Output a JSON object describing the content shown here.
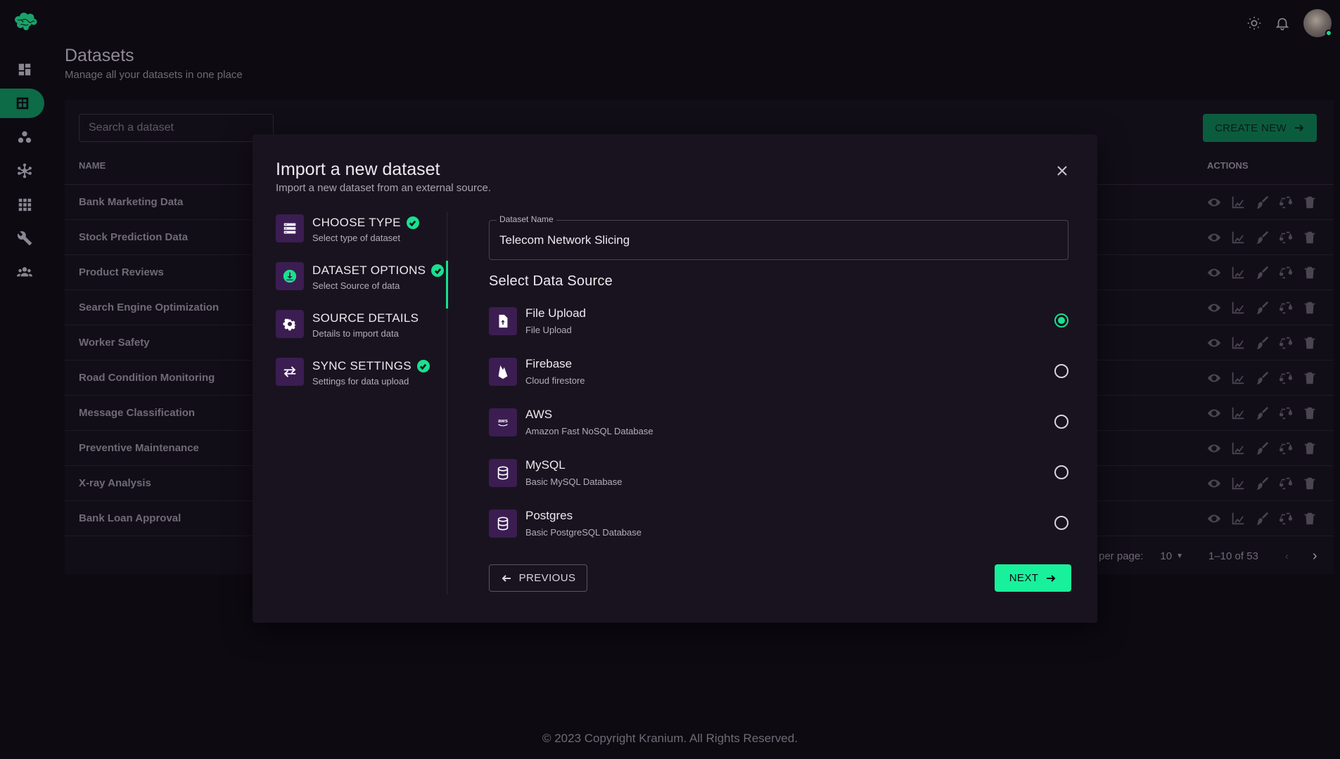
{
  "page": {
    "title": "Datasets",
    "subtitle": "Manage all your datasets in one place",
    "footer": "© 2023 Copyright Kranium. All Rights Reserved."
  },
  "sidebar": {
    "items": [
      {
        "icon": "dashboard-icon",
        "active": false
      },
      {
        "icon": "datasets-icon",
        "active": true
      },
      {
        "icon": "clusters-icon",
        "active": false
      },
      {
        "icon": "network-icon",
        "active": false
      },
      {
        "icon": "apps-grid-icon",
        "active": false
      },
      {
        "icon": "wrench-icon",
        "active": false
      },
      {
        "icon": "team-icon",
        "active": false
      }
    ]
  },
  "table": {
    "search_placeholder": "Search a dataset",
    "create_label": "CREATE NEW",
    "col_name": "NAME",
    "col_actions": "ACTIONS",
    "rows": [
      "Bank Marketing Data",
      "Stock Prediction Data",
      "Product Reviews",
      "Search Engine Optimization",
      "Worker Safety",
      "Road Condition Monitoring",
      "Message Classification",
      "Preventive Maintenance",
      "X-ray Analysis",
      "Bank Loan Approval"
    ],
    "pagination": {
      "per_page_label": "per page:",
      "per_page_value": "10",
      "range": "1–10 of 53"
    }
  },
  "modal": {
    "title": "Import a new dataset",
    "subtitle": "Import a new dataset from an external source.",
    "steps": [
      {
        "title": "CHOOSE TYPE",
        "sub": "Select type of dataset",
        "checked": true
      },
      {
        "title": "DATASET OPTIONS",
        "sub": "Select Source of data",
        "checked": true
      },
      {
        "title": "SOURCE DETAILS",
        "sub": "Details to import data",
        "checked": false
      },
      {
        "title": "SYNC SETTINGS",
        "sub": "Settings for data upload",
        "checked": true
      }
    ],
    "field_label": "Dataset Name",
    "field_value": "Telecom Network Slicing",
    "sources_heading": "Select Data Source",
    "sources": [
      {
        "name": "File Upload",
        "desc": "File Upload",
        "selected": true
      },
      {
        "name": "Firebase",
        "desc": "Cloud firestore",
        "selected": false
      },
      {
        "name": "AWS",
        "desc": "Amazon Fast NoSQL Database",
        "selected": false
      },
      {
        "name": "MySQL",
        "desc": "Basic MySQL Database",
        "selected": false
      },
      {
        "name": "Postgres",
        "desc": "Basic PostgreSQL Database",
        "selected": false
      }
    ],
    "prev_label": "PREVIOUS",
    "next_label": "NEXT"
  },
  "colors": {
    "accent": "#19e08f",
    "step_icon_bg": "#3b1d52",
    "modal_bg": "#19131f",
    "page_bg": "#0d0a12"
  }
}
